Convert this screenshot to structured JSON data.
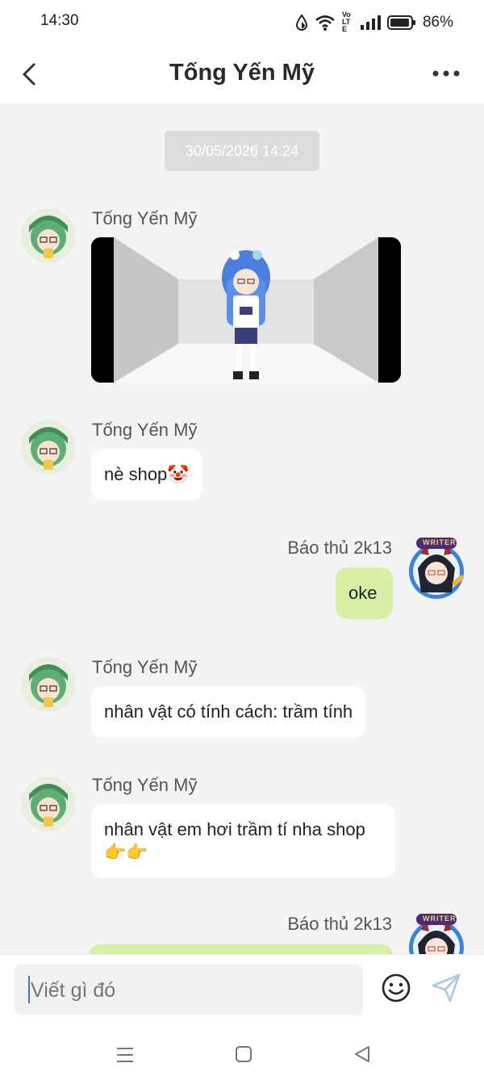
{
  "status_bar": {
    "time": "14:30",
    "network_label": "Vo LTE",
    "battery": "86%"
  },
  "header": {
    "title": "Tống Yến Mỹ"
  },
  "chat": {
    "date_badge": "30/05/2026 14:24",
    "messages": [
      {
        "sender": "Tống Yến Mỹ",
        "type": "image"
      },
      {
        "sender": "Tống Yến Mỹ",
        "text": "nè shop🤡"
      },
      {
        "sender": "Báo thủ 2k13",
        "text": "oke"
      },
      {
        "sender": "Tống Yến Mỹ",
        "text": "nhân vật có tính cách: trầm tính"
      },
      {
        "sender": "Tống Yến Mỹ",
        "text": "nhân vật em hơi trầm tí nha shop 👉👉"
      },
      {
        "sender": "Báo thủ 2k13",
        "text": ""
      }
    ],
    "my_avatar_badge": "WRITER"
  },
  "input": {
    "placeholder": "Viết gì đó"
  },
  "icons": {
    "back": "chevron-left-icon",
    "more": "more-horizontal-icon",
    "emoji": "smiley-icon",
    "send": "send-icon",
    "nav_menu": "menu-icon",
    "nav_home": "square-icon",
    "nav_back": "triangle-back-icon"
  },
  "colors": {
    "my_bubble": "#d8f0a6",
    "their_bubble": "#ffffff",
    "chat_bg": "#f4f4f4",
    "caret": "#2d7be0",
    "send_icon": "#a9c7ec"
  }
}
